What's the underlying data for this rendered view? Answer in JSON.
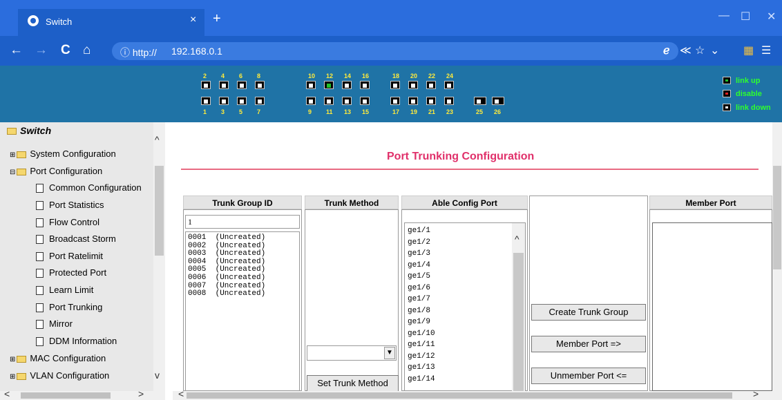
{
  "browser": {
    "tab_title": "Switch",
    "tab_close": "×",
    "new_tab": "+",
    "url_prefix": "ⓘ http://",
    "url": "192.168.0.1",
    "window_controls": [
      "—",
      "☐",
      "✕"
    ],
    "nav": {
      "back": "←",
      "forward": "→",
      "reload": "C",
      "home": "⌂"
    },
    "toolbar_icons": [
      "ℯ",
      "≪",
      "☆",
      "⌄",
      "▦",
      "☰"
    ]
  },
  "banner": {
    "top_ports": [
      "2",
      "4",
      "6",
      "8",
      "10",
      "12",
      "14",
      "16",
      "18",
      "20",
      "22",
      "24"
    ],
    "bottom_ports": [
      "1",
      "3",
      "5",
      "7",
      "9",
      "11",
      "13",
      "15",
      "17",
      "19",
      "21",
      "23"
    ],
    "fiber_ports": [
      "25",
      "26"
    ],
    "active_port": "12",
    "legend": [
      {
        "label": "link up",
        "color": "#22c22a"
      },
      {
        "label": "disable",
        "color": "#e02020"
      },
      {
        "label": "link down",
        "color": "#ffffff"
      }
    ]
  },
  "sidebar": {
    "root": "Switch",
    "items": [
      {
        "label": "System Configuration",
        "type": "folder",
        "expanded": false
      },
      {
        "label": "Port Configuration",
        "type": "folder",
        "expanded": true
      },
      {
        "label": "Common Configuration",
        "type": "page"
      },
      {
        "label": "Port Statistics",
        "type": "page"
      },
      {
        "label": "Flow Control",
        "type": "page"
      },
      {
        "label": "Broadcast Storm",
        "type": "page"
      },
      {
        "label": "Port Ratelimit",
        "type": "page"
      },
      {
        "label": "Protected Port",
        "type": "page"
      },
      {
        "label": "Learn Limit",
        "type": "page"
      },
      {
        "label": "Port Trunking",
        "type": "page"
      },
      {
        "label": "Mirror",
        "type": "page"
      },
      {
        "label": "DDM Information",
        "type": "page"
      },
      {
        "label": "MAC Configuration",
        "type": "folder",
        "expanded": false
      },
      {
        "label": "VLAN Configuration",
        "type": "folder",
        "expanded": false
      }
    ]
  },
  "main": {
    "title": "Port Trunking Configuration",
    "columns": {
      "trunk_group_id": "Trunk Group ID",
      "trunk_method": "Trunk Method",
      "able_config_port": "Able Config Port",
      "member_port": "Member Port"
    },
    "trunk_id_input": "1",
    "trunk_groups": [
      "0001  (Uncreated)",
      "0002  (Uncreated)",
      "0003  (Uncreated)",
      "0004  (Uncreated)",
      "0005  (Uncreated)",
      "0006  (Uncreated)",
      "0007  (Uncreated)",
      "0008  (Uncreated)"
    ],
    "able_ports": [
      "ge1/1",
      "ge1/2",
      "ge1/3",
      "ge1/4",
      "ge1/5",
      "ge1/6",
      "ge1/7",
      "ge1/8",
      "ge1/9",
      "ge1/10",
      "ge1/11",
      "ge1/12",
      "ge1/13",
      "ge1/14"
    ],
    "trunk_method_value": "",
    "buttons": {
      "set_trunk_method": "Set Trunk Method",
      "create_trunk_group": "Create Trunk Group",
      "member_port": "Member Port =>",
      "unmember_port": "Unmember Port <="
    }
  }
}
